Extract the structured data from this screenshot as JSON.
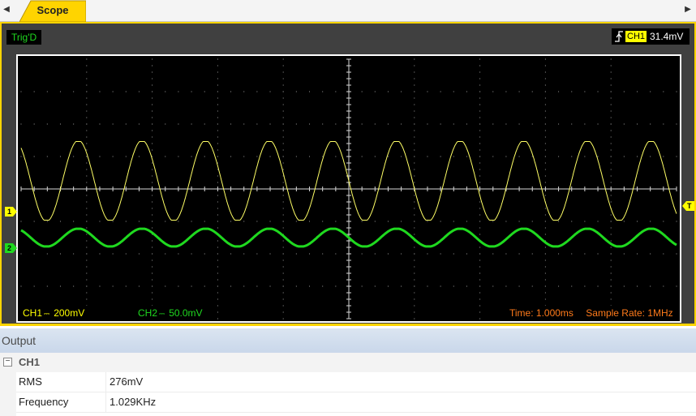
{
  "tabs": [
    {
      "label": "Scope"
    }
  ],
  "scope": {
    "trigger_status": "Trig'D",
    "trigger_channel": "CH1",
    "trigger_level": "31.4mV",
    "ch1_marker": "1",
    "ch2_marker": "2",
    "trigger_marker": "T",
    "ch1_label": "CH1",
    "ch1_scale": "200mV",
    "ch2_label": "CH2",
    "ch2_scale": "50.0mV",
    "time_base": "Time: 1.000ms",
    "sample_rate": "Sample Rate: 1MHz",
    "colors": {
      "ch1": "#ffff66",
      "ch2": "#1fd91f",
      "frame": "#ffd400",
      "time": "#ff7a1a"
    },
    "waveforms": {
      "cycles_on_screen": 10.3,
      "ch1": {
        "amplitude_div": 1.25,
        "offset_div": 0.25,
        "phase": 0.1
      },
      "ch2": {
        "amplitude_div": 0.28,
        "offset_div": -1.5,
        "phase": 0.1
      }
    }
  },
  "output": {
    "title": "Output",
    "group": "CH1",
    "collapse_glyph": "−",
    "rows": [
      {
        "name": "RMS",
        "value": "276mV"
      },
      {
        "name": "Frequency",
        "value": "1.029KHz"
      }
    ]
  }
}
